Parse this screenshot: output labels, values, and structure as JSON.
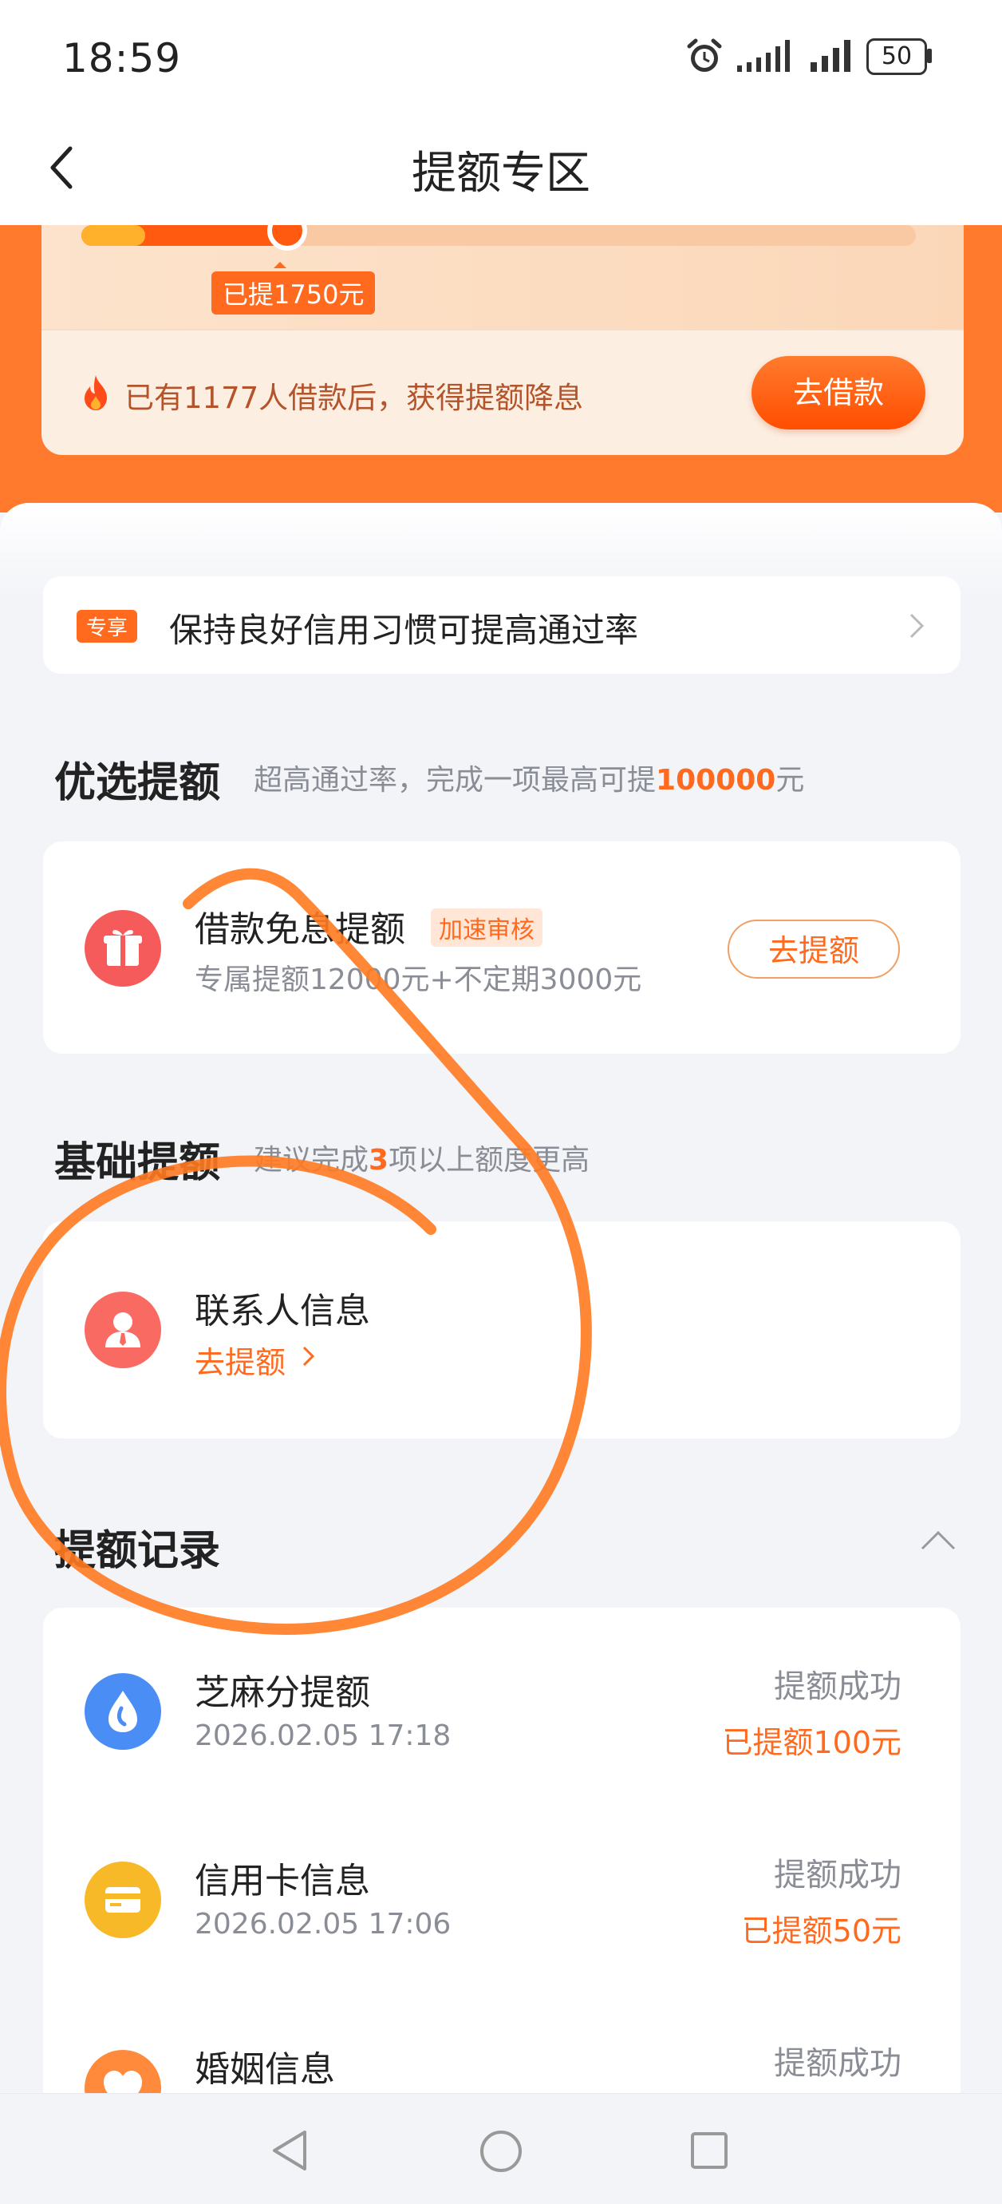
{
  "status_bar": {
    "time": "18:59",
    "battery": "50"
  },
  "header": {
    "title": "提额专区"
  },
  "hero": {
    "progress_fraction": 0.24,
    "progress_label": "已提1750元",
    "note": "已有1177人借款后，获得提额降息",
    "borrow_button": "去借款"
  },
  "tip": {
    "tag": "专享",
    "text": "保持良好信用习惯可提高通过率"
  },
  "preferred": {
    "title": "优选提额",
    "subtitle_prefix": "超高通过率，完成一项最高可提",
    "subtitle_highlight": "100000",
    "subtitle_suffix": "元",
    "item": {
      "title": "借款免息提额",
      "tag": "加速审核",
      "desc": "专属提额12000元+不定期3000元",
      "button": "去提额"
    }
  },
  "basic": {
    "title": "基础提额",
    "subtitle_prefix": "建议完成",
    "subtitle_highlight": "3",
    "subtitle_suffix": "项以上额度更高",
    "item": {
      "title": "联系人信息",
      "link": "去提额"
    }
  },
  "records": {
    "title": "提额记录",
    "items": [
      {
        "name": "芝麻分提额",
        "date": "2026.02.05 17:18",
        "status": "提额成功",
        "amount": "已提额100元",
        "color": "#4a8ef5"
      },
      {
        "name": "信用卡信息",
        "date": "2026.02.05 17:06",
        "status": "提额成功",
        "amount": "已提额50元",
        "color": "#f7b928"
      },
      {
        "name": "婚姻信息",
        "date": "",
        "status": "提额成功",
        "amount": "",
        "color": "#ff8a3c"
      }
    ]
  },
  "colors": {
    "accent": "#ff6a1e",
    "hero": "#ff7a2c",
    "annotation": "#ff7a20"
  }
}
